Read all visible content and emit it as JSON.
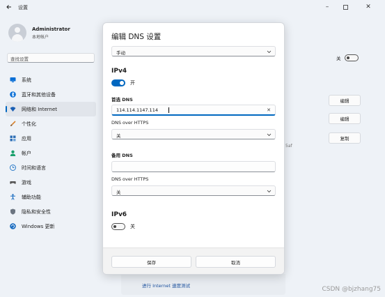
{
  "window": {
    "title": "设置",
    "back_icon": "back-arrow-icon",
    "controls": [
      "minimize-icon",
      "maximize-icon",
      "close-icon"
    ]
  },
  "profile": {
    "name": "Administrator",
    "account_type": "本地帐户"
  },
  "search": {
    "placeholder": "查找设置"
  },
  "sidebar": {
    "items": [
      {
        "label": "系统",
        "icon": "system-icon",
        "color": "#0a6fd6"
      },
      {
        "label": "蓝牙和其他设备",
        "icon": "bluetooth-icon",
        "color": "#0a6fd6"
      },
      {
        "label": "网络和 Internet",
        "icon": "wifi-icon",
        "color": "#1a5fb4",
        "active": true
      },
      {
        "label": "个性化",
        "icon": "brush-icon",
        "color": "#d9822b"
      },
      {
        "label": "应用",
        "icon": "apps-icon",
        "color": "#2f6fb5"
      },
      {
        "label": "帐户",
        "icon": "account-icon",
        "color": "#1aa06d"
      },
      {
        "label": "时间和语言",
        "icon": "globe-clock-icon",
        "color": "#2a7ac7"
      },
      {
        "label": "游戏",
        "icon": "gamepad-icon",
        "color": "#555555"
      },
      {
        "label": "辅助功能",
        "icon": "accessibility-icon",
        "color": "#1a6cc0"
      },
      {
        "label": "隐私和安全性",
        "icon": "shield-icon",
        "color": "#6b7480"
      },
      {
        "label": "Windows 更新",
        "icon": "update-icon",
        "color": "#1a6cc0"
      }
    ]
  },
  "background": {
    "toggle_label": "关",
    "edit_button_1": "编辑",
    "edit_button_2": "编辑",
    "copy_button": "复制",
    "fragment_text": "5af",
    "speed_test_link": "进行 Internet 速度测试"
  },
  "dialog": {
    "title": "编辑 DNS 设置",
    "mode_select": "手动",
    "ipv4": {
      "heading": "IPv4",
      "toggle_on": true,
      "toggle_label": "开",
      "preferred_label": "首选 DNS",
      "preferred_value": "114.114.1147.114",
      "preferred_doh_label": "DNS over HTTPS",
      "preferred_doh_value": "关",
      "alternate_label": "备用 DNS",
      "alternate_value": "",
      "alternate_doh_label": "DNS over HTTPS",
      "alternate_doh_value": "关"
    },
    "ipv6": {
      "heading": "IPv6",
      "toggle_on": false,
      "toggle_label": "关"
    },
    "save_button": "保存",
    "cancel_button": "取消"
  },
  "watermark": "CSDN @bjzhang75",
  "colors": {
    "accent": "#0067c0",
    "window_bg": "#eef2f7",
    "dialog_bg": "#ffffff"
  }
}
